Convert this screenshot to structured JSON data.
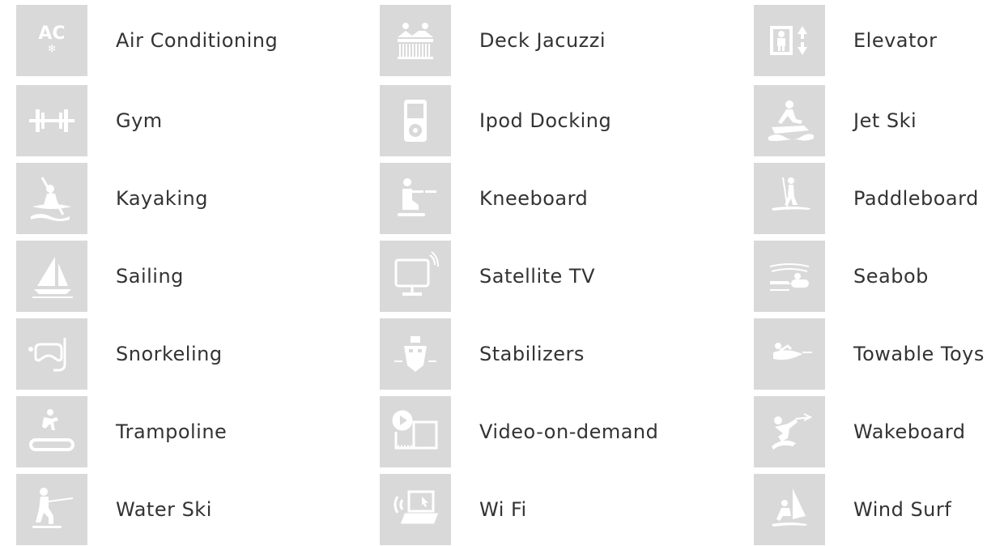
{
  "amenities": [
    {
      "label": "Air Conditioning",
      "icon": "air-conditioning-icon"
    },
    {
      "label": "Deck Jacuzzi",
      "icon": "deck-jacuzzi-icon"
    },
    {
      "label": "Elevator",
      "icon": "elevator-icon"
    },
    {
      "label": "Gym",
      "icon": "gym-icon"
    },
    {
      "label": "Ipod Docking",
      "icon": "ipod-docking-icon"
    },
    {
      "label": "Jet Ski",
      "icon": "jet-ski-icon"
    },
    {
      "label": "Kayaking",
      "icon": "kayaking-icon"
    },
    {
      "label": "Kneeboard",
      "icon": "kneeboard-icon"
    },
    {
      "label": "Paddleboard",
      "icon": "paddleboard-icon"
    },
    {
      "label": "Sailing",
      "icon": "sailing-icon"
    },
    {
      "label": "Satellite TV",
      "icon": "satellite-tv-icon"
    },
    {
      "label": "Seabob",
      "icon": "seabob-icon"
    },
    {
      "label": "Snorkeling",
      "icon": "snorkeling-icon"
    },
    {
      "label": "Stabilizers",
      "icon": "stabilizers-icon"
    },
    {
      "label": "Towable Toys",
      "icon": "towable-toys-icon"
    },
    {
      "label": "Trampoline",
      "icon": "trampoline-icon"
    },
    {
      "label": "Video-on-demand",
      "icon": "video-on-demand-icon"
    },
    {
      "label": "Wakeboard",
      "icon": "wakeboard-icon"
    },
    {
      "label": "Water Ski",
      "icon": "water-ski-icon"
    },
    {
      "label": "Wi Fi",
      "icon": "wifi-icon"
    },
    {
      "label": "Wind Surf",
      "icon": "wind-surf-icon"
    }
  ],
  "colors": {
    "tile": "#d9d9d9",
    "icon": "#ffffff",
    "text": "#333333"
  }
}
